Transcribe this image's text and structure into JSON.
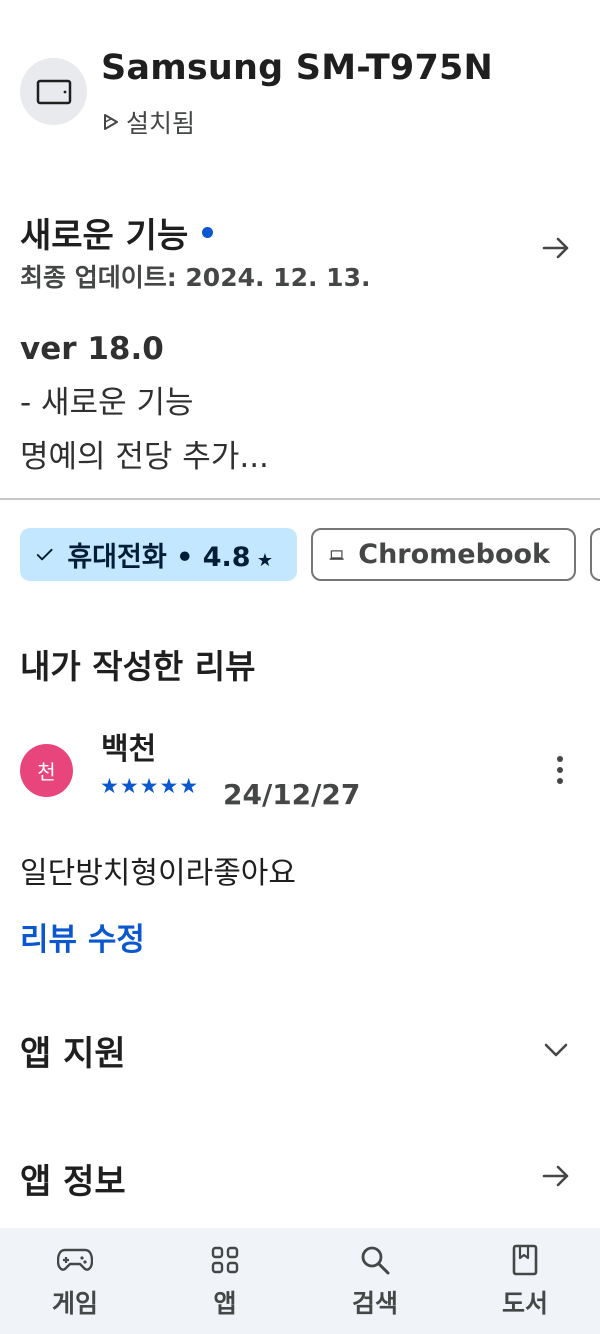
{
  "device": {
    "name": "Samsung SM-T975N",
    "status": "설치됨",
    "icon": "tablet-icon"
  },
  "whats_new": {
    "title": "새로운 기능",
    "last_updated": "최종 업데이트: 2024. 12. 13.",
    "version": "ver 18.0",
    "line1": "- 새로운 기능",
    "line2": "명예의 전당 추가..."
  },
  "device_chips": [
    {
      "label": "휴대전화 • 4.8",
      "selected": true,
      "icon": "check-icon"
    },
    {
      "label": "Chromebook",
      "selected": false,
      "icon": "laptop-icon"
    }
  ],
  "my_review": {
    "section_title": "내가 작성한 리뷰",
    "avatar_initial": "천",
    "reviewer": "백천",
    "rating": 5,
    "stars": "★★★★★",
    "date": "24/12/27",
    "text": "일단방치형이라좋아요",
    "edit_label": "리뷰 수정"
  },
  "app_support": {
    "title": "앱 지원"
  },
  "app_info": {
    "title": "앱 정보"
  },
  "bottom_nav": [
    {
      "label": "게임",
      "icon": "gamepad-icon"
    },
    {
      "label": "앱",
      "icon": "apps-grid-icon"
    },
    {
      "label": "검색",
      "icon": "search-icon"
    },
    {
      "label": "도서",
      "icon": "book-icon"
    }
  ],
  "colors": {
    "accent": "#0b57d0",
    "chip_selected": "#c2e7ff",
    "avatar": "#e8457c",
    "nav_bg": "#f0f4f9"
  }
}
